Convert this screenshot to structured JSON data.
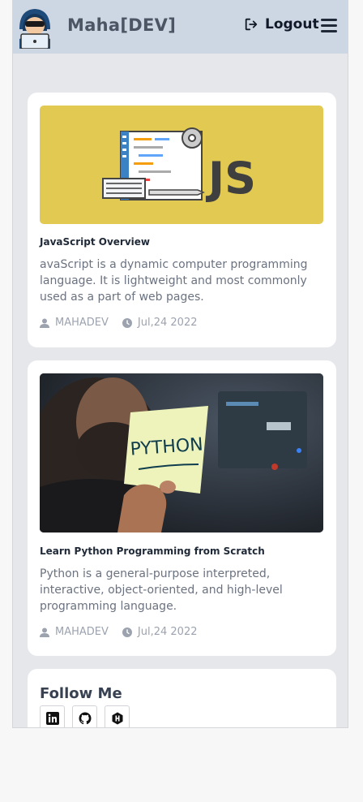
{
  "header": {
    "brand": "Maha[DEV]",
    "logout_label": "Logout",
    "menu_icon": "hamburger-menu-icon",
    "avatar_icon": "hacker-avatar-icon"
  },
  "posts": [
    {
      "title": "JavaScript Overview",
      "description": "avaScript is a dynamic computer programming language. It is lightweight and most commonly used as a part of web pages.",
      "author": "MAHADEV",
      "date": "Jul,24 2022",
      "image_text": "JS"
    },
    {
      "title": "Learn Python Programming from Scratch",
      "description": "Python is a general-purpose interpreted, interactive, object-oriented, and high-level programming language.",
      "author": "MAHADEV",
      "date": "Jul,24 2022",
      "image_text": "PYTHON"
    }
  ],
  "follow": {
    "title": "Follow Me",
    "links": [
      "linkedin-icon",
      "github-icon",
      "hashnode-icon"
    ]
  },
  "colors": {
    "header_bg": "#cdd7e4",
    "page_bg": "#e5e7eb",
    "js_banner": "#e2c952"
  }
}
